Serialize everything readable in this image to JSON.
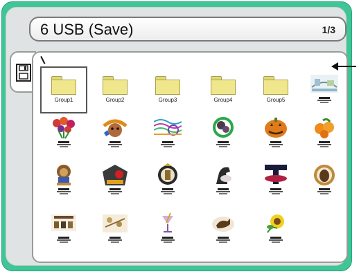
{
  "header": {
    "title": "6 USB (Save)",
    "page_indicator": "1/3"
  },
  "sidebar": {
    "save_icon": "floppy-disk-icon"
  },
  "folders": [
    {
      "label": "Group1",
      "selected": true
    },
    {
      "label": "Group2",
      "selected": false
    },
    {
      "label": "Group3",
      "selected": false
    },
    {
      "label": "Group4",
      "selected": false
    },
    {
      "label": "Group5",
      "selected": false
    }
  ],
  "designs": [
    {
      "name": "design-thumbnail",
      "icon": "bridge-scene"
    },
    {
      "name": "design-thumbnail",
      "icon": "flowers"
    },
    {
      "name": "design-thumbnail",
      "icon": "bulldog"
    },
    {
      "name": "design-thumbnail",
      "icon": "wave-lines"
    },
    {
      "name": "design-thumbnail",
      "icon": "poodle-green-circle"
    },
    {
      "name": "design-thumbnail",
      "icon": "pumpkin"
    },
    {
      "name": "design-thumbnail",
      "icon": "orange-fruits"
    },
    {
      "name": "design-thumbnail",
      "icon": "lion"
    },
    {
      "name": "design-thumbnail",
      "icon": "pagoda-sun"
    },
    {
      "name": "design-thumbnail",
      "icon": "crest"
    },
    {
      "name": "design-thumbnail",
      "icon": "horse"
    },
    {
      "name": "design-thumbnail",
      "icon": "letter-t"
    },
    {
      "name": "design-thumbnail",
      "icon": "dog-circle"
    },
    {
      "name": "design-thumbnail",
      "icon": "dog-club"
    },
    {
      "name": "design-thumbnail",
      "icon": "pine-sprigs"
    },
    {
      "name": "design-thumbnail",
      "icon": "cocktail"
    },
    {
      "name": "design-thumbnail",
      "icon": "dog-silhouette"
    },
    {
      "name": "design-thumbnail",
      "icon": "sunflower"
    }
  ],
  "colors": {
    "frame": "#3fc596",
    "panel": "#dfe3e3",
    "folder": "#f0e68c"
  }
}
